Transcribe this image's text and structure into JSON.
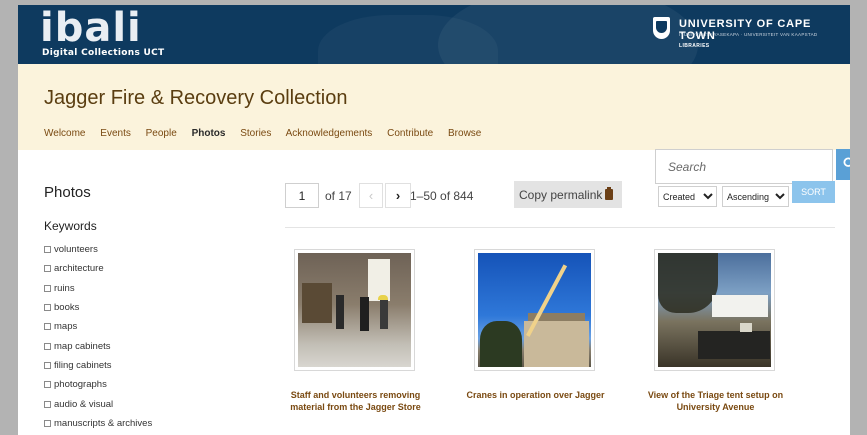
{
  "header": {
    "logo_text": "ibali",
    "logo_subtitle": "Digital Collections UCT",
    "university_name": "UNIVERSITY OF CAPE TOWN",
    "university_tagline": "IYUNIVESITHI YASEKAPA · UNIVERSITEIT VAN KAAPSTAD",
    "university_unit": "LIBRARIES"
  },
  "collection": {
    "title": "Jagger Fire & Recovery Collection",
    "nav": [
      {
        "label": "Welcome",
        "active": false
      },
      {
        "label": "Events",
        "active": false
      },
      {
        "label": "People",
        "active": false
      },
      {
        "label": "Photos",
        "active": true
      },
      {
        "label": "Stories",
        "active": false
      },
      {
        "label": "Acknowledgements",
        "active": false
      },
      {
        "label": "Contribute",
        "active": false
      },
      {
        "label": "Browse",
        "active": false
      }
    ]
  },
  "search": {
    "placeholder": "Search",
    "button_icon": "search-icon"
  },
  "sidebar": {
    "title": "Photos",
    "keywords_title": "Keywords",
    "keywords": [
      "volunteers",
      "architecture",
      "ruins",
      "books",
      "maps",
      "map cabinets",
      "filing cabinets",
      "photographs",
      "audio & visual",
      "manuscripts & archives"
    ]
  },
  "pagination": {
    "page": "1",
    "of_text": "of 17",
    "prev_label": "‹",
    "next_label": "›",
    "range_text": "1–50 of 844"
  },
  "toolbar": {
    "permalink_label": "Copy permalink",
    "permalink_icon": "clipboard-icon",
    "sort_field": "Created",
    "sort_order": "Ascending",
    "sort_button": "SORT"
  },
  "items": [
    {
      "caption": "Staff and volunteers removing material from the Jagger Store"
    },
    {
      "caption": "Cranes in operation over Jagger"
    },
    {
      "caption": "View of the Triage tent setup on University Avenue"
    }
  ],
  "colors": {
    "banner": "#0e3a5f",
    "collection_band": "#fbf3dc",
    "link_brown": "#7a4a12",
    "accent_blue": "#5aa0d6"
  }
}
